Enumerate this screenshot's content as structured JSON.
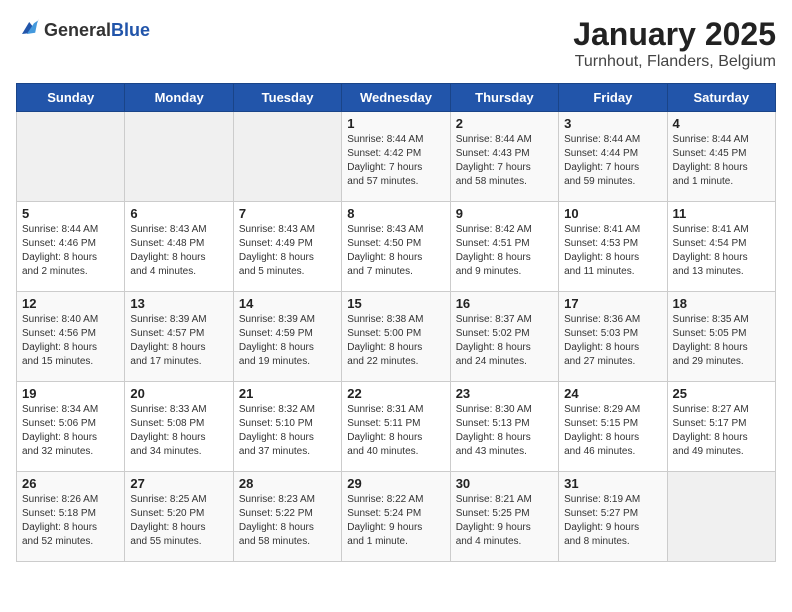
{
  "header": {
    "logo_general": "General",
    "logo_blue": "Blue",
    "title": "January 2025",
    "subtitle": "Turnhout, Flanders, Belgium"
  },
  "weekdays": [
    "Sunday",
    "Monday",
    "Tuesday",
    "Wednesday",
    "Thursday",
    "Friday",
    "Saturday"
  ],
  "weeks": [
    [
      {
        "day": "",
        "info": ""
      },
      {
        "day": "",
        "info": ""
      },
      {
        "day": "",
        "info": ""
      },
      {
        "day": "1",
        "info": "Sunrise: 8:44 AM\nSunset: 4:42 PM\nDaylight: 7 hours\nand 57 minutes."
      },
      {
        "day": "2",
        "info": "Sunrise: 8:44 AM\nSunset: 4:43 PM\nDaylight: 7 hours\nand 58 minutes."
      },
      {
        "day": "3",
        "info": "Sunrise: 8:44 AM\nSunset: 4:44 PM\nDaylight: 7 hours\nand 59 minutes."
      },
      {
        "day": "4",
        "info": "Sunrise: 8:44 AM\nSunset: 4:45 PM\nDaylight: 8 hours\nand 1 minute."
      }
    ],
    [
      {
        "day": "5",
        "info": "Sunrise: 8:44 AM\nSunset: 4:46 PM\nDaylight: 8 hours\nand 2 minutes."
      },
      {
        "day": "6",
        "info": "Sunrise: 8:43 AM\nSunset: 4:48 PM\nDaylight: 8 hours\nand 4 minutes."
      },
      {
        "day": "7",
        "info": "Sunrise: 8:43 AM\nSunset: 4:49 PM\nDaylight: 8 hours\nand 5 minutes."
      },
      {
        "day": "8",
        "info": "Sunrise: 8:43 AM\nSunset: 4:50 PM\nDaylight: 8 hours\nand 7 minutes."
      },
      {
        "day": "9",
        "info": "Sunrise: 8:42 AM\nSunset: 4:51 PM\nDaylight: 8 hours\nand 9 minutes."
      },
      {
        "day": "10",
        "info": "Sunrise: 8:41 AM\nSunset: 4:53 PM\nDaylight: 8 hours\nand 11 minutes."
      },
      {
        "day": "11",
        "info": "Sunrise: 8:41 AM\nSunset: 4:54 PM\nDaylight: 8 hours\nand 13 minutes."
      }
    ],
    [
      {
        "day": "12",
        "info": "Sunrise: 8:40 AM\nSunset: 4:56 PM\nDaylight: 8 hours\nand 15 minutes."
      },
      {
        "day": "13",
        "info": "Sunrise: 8:39 AM\nSunset: 4:57 PM\nDaylight: 8 hours\nand 17 minutes."
      },
      {
        "day": "14",
        "info": "Sunrise: 8:39 AM\nSunset: 4:59 PM\nDaylight: 8 hours\nand 19 minutes."
      },
      {
        "day": "15",
        "info": "Sunrise: 8:38 AM\nSunset: 5:00 PM\nDaylight: 8 hours\nand 22 minutes."
      },
      {
        "day": "16",
        "info": "Sunrise: 8:37 AM\nSunset: 5:02 PM\nDaylight: 8 hours\nand 24 minutes."
      },
      {
        "day": "17",
        "info": "Sunrise: 8:36 AM\nSunset: 5:03 PM\nDaylight: 8 hours\nand 27 minutes."
      },
      {
        "day": "18",
        "info": "Sunrise: 8:35 AM\nSunset: 5:05 PM\nDaylight: 8 hours\nand 29 minutes."
      }
    ],
    [
      {
        "day": "19",
        "info": "Sunrise: 8:34 AM\nSunset: 5:06 PM\nDaylight: 8 hours\nand 32 minutes."
      },
      {
        "day": "20",
        "info": "Sunrise: 8:33 AM\nSunset: 5:08 PM\nDaylight: 8 hours\nand 34 minutes."
      },
      {
        "day": "21",
        "info": "Sunrise: 8:32 AM\nSunset: 5:10 PM\nDaylight: 8 hours\nand 37 minutes."
      },
      {
        "day": "22",
        "info": "Sunrise: 8:31 AM\nSunset: 5:11 PM\nDaylight: 8 hours\nand 40 minutes."
      },
      {
        "day": "23",
        "info": "Sunrise: 8:30 AM\nSunset: 5:13 PM\nDaylight: 8 hours\nand 43 minutes."
      },
      {
        "day": "24",
        "info": "Sunrise: 8:29 AM\nSunset: 5:15 PM\nDaylight: 8 hours\nand 46 minutes."
      },
      {
        "day": "25",
        "info": "Sunrise: 8:27 AM\nSunset: 5:17 PM\nDaylight: 8 hours\nand 49 minutes."
      }
    ],
    [
      {
        "day": "26",
        "info": "Sunrise: 8:26 AM\nSunset: 5:18 PM\nDaylight: 8 hours\nand 52 minutes."
      },
      {
        "day": "27",
        "info": "Sunrise: 8:25 AM\nSunset: 5:20 PM\nDaylight: 8 hours\nand 55 minutes."
      },
      {
        "day": "28",
        "info": "Sunrise: 8:23 AM\nSunset: 5:22 PM\nDaylight: 8 hours\nand 58 minutes."
      },
      {
        "day": "29",
        "info": "Sunrise: 8:22 AM\nSunset: 5:24 PM\nDaylight: 9 hours\nand 1 minute."
      },
      {
        "day": "30",
        "info": "Sunrise: 8:21 AM\nSunset: 5:25 PM\nDaylight: 9 hours\nand 4 minutes."
      },
      {
        "day": "31",
        "info": "Sunrise: 8:19 AM\nSunset: 5:27 PM\nDaylight: 9 hours\nand 8 minutes."
      },
      {
        "day": "",
        "info": ""
      }
    ]
  ]
}
